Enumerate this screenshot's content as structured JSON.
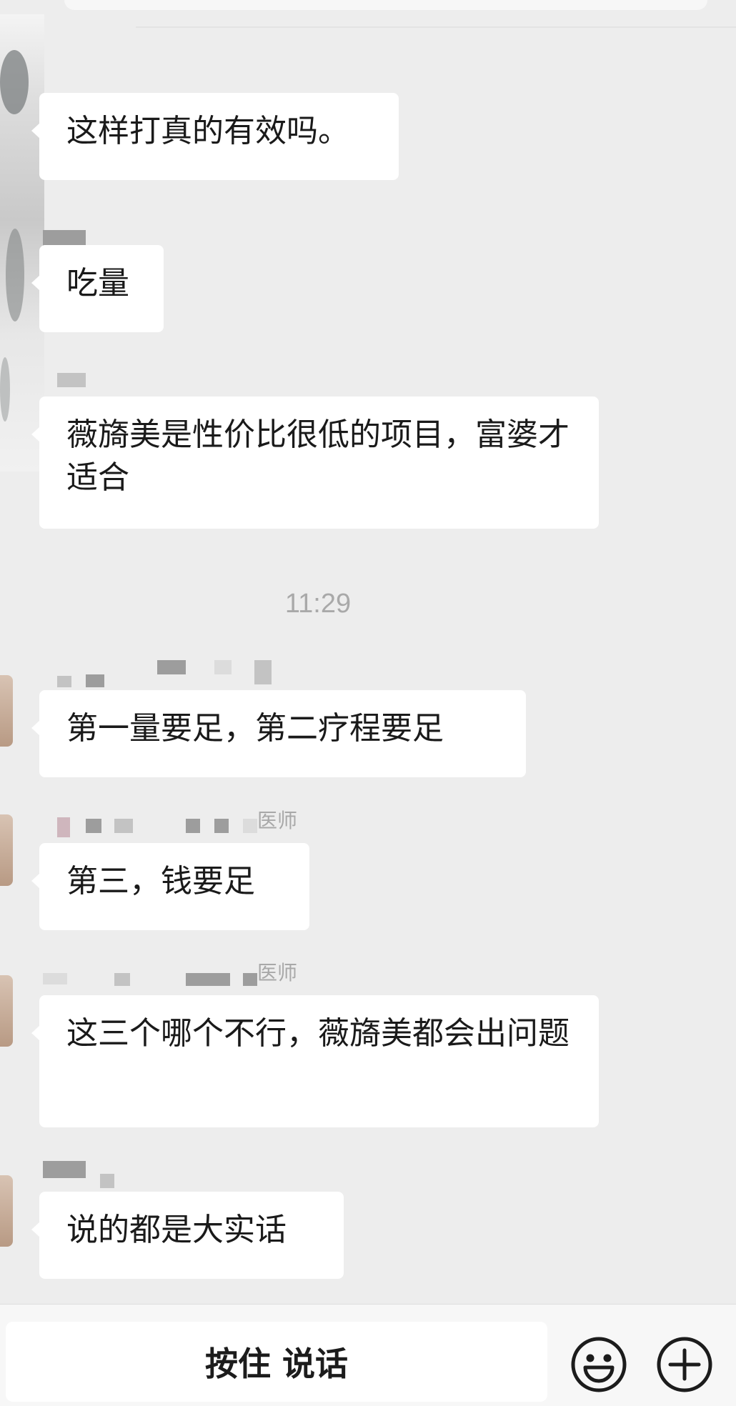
{
  "chat": {
    "messages": [
      {
        "text": "这样打真的有效吗。"
      },
      {
        "text": "吃量"
      },
      {
        "text": "薇旖美是性价比很低的项目，富婆才适合"
      },
      {
        "text": "第一量要足，第二疗程要足"
      },
      {
        "text": "第三，钱要足"
      },
      {
        "text": "这三个哪个不行，薇旖美都会出问题"
      },
      {
        "text": "说的都是大实话"
      }
    ],
    "time_divider": "11:29",
    "name_suffixes": [
      "医师",
      "医师"
    ]
  },
  "input_bar": {
    "hold_to_talk_label": "按住 说话",
    "emoji_icon": "emoji-smile-icon",
    "plus_icon": "plus-circle-icon"
  },
  "colors": {
    "background": "#ededed",
    "bubble": "#ffffff",
    "timestamp": "#a9a9a9"
  }
}
